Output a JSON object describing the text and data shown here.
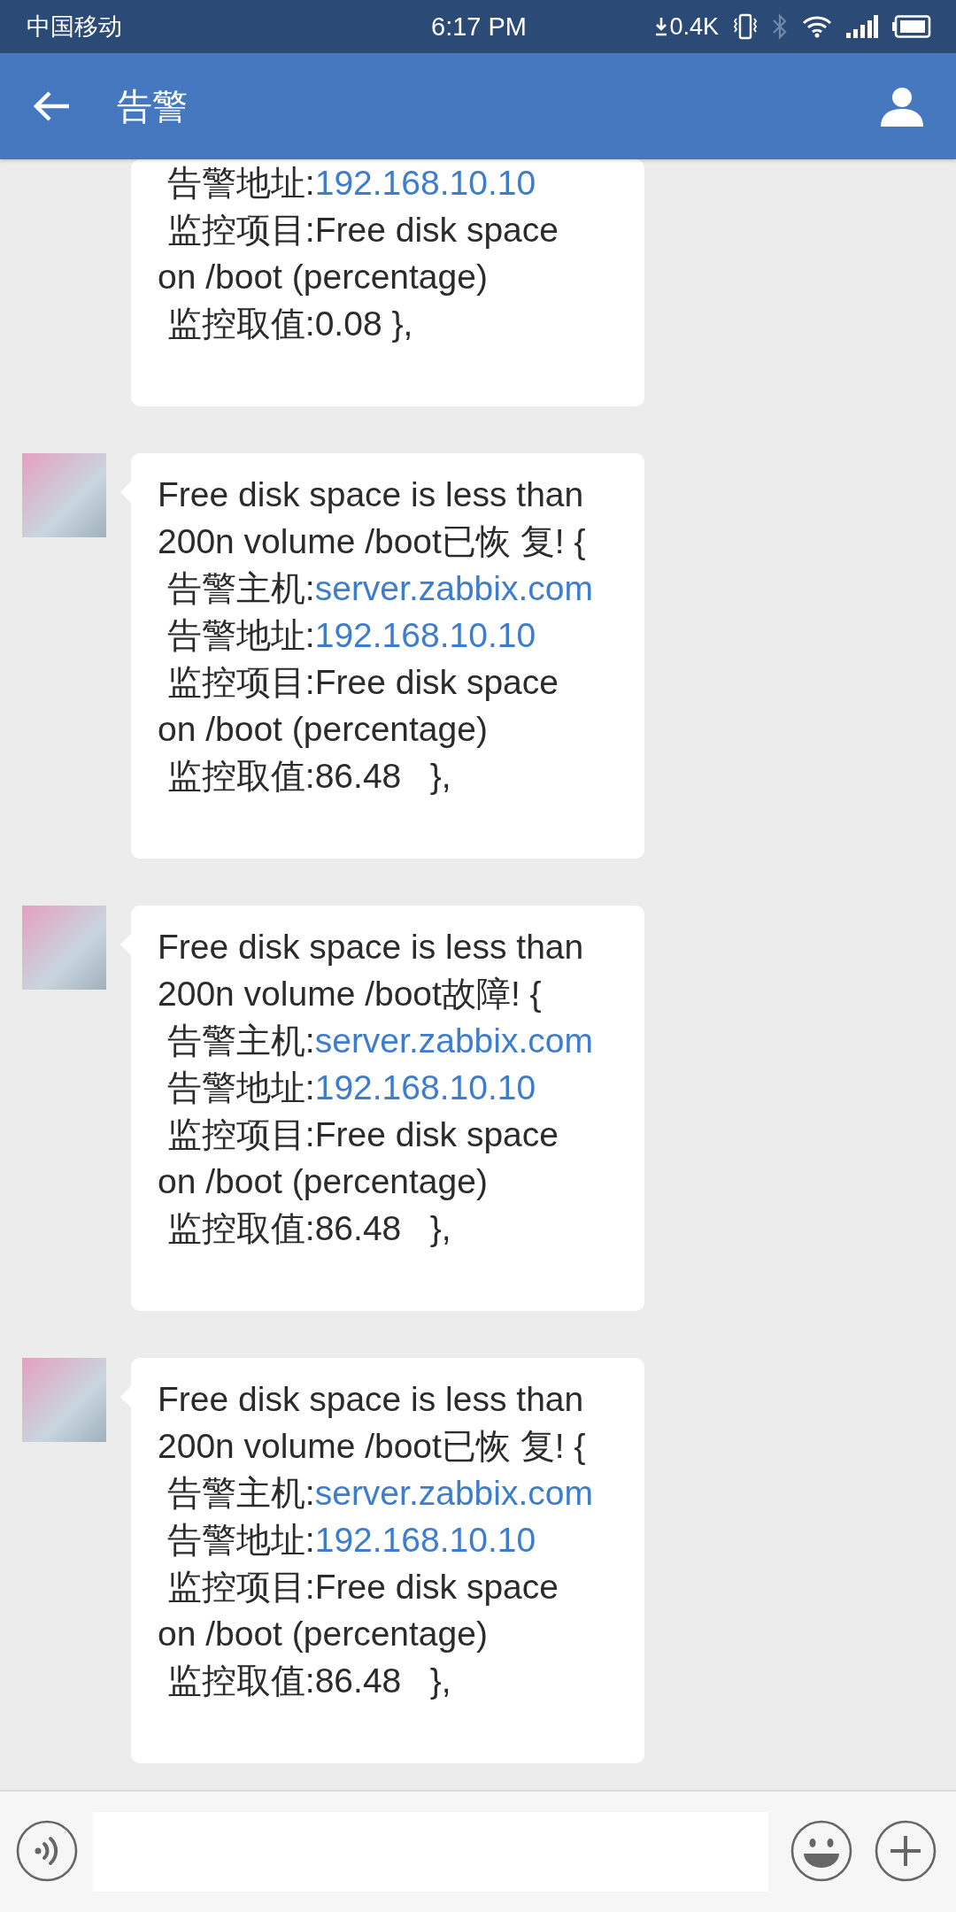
{
  "status_bar": {
    "carrier": "中国移动",
    "time": "6:17 PM",
    "net_speed": "0.4K"
  },
  "header": {
    "title": "告警"
  },
  "messages": [
    {
      "avatar": false,
      "lines": [
        {
          "label": " 告警地址:",
          "link": "192.168.10.10"
        },
        {
          "label": " 监控项目:Free disk space\non /boot (percentage)"
        },
        {
          "label": " 监控取值:0.08 },"
        }
      ]
    },
    {
      "avatar": true,
      "lines": [
        {
          "label": "Free disk space is less than\n200n volume /boot已恢 复! {"
        },
        {
          "label": " 告警主机:",
          "link": "server.zabbix.com"
        },
        {
          "label": " 告警地址:",
          "link": "192.168.10.10"
        },
        {
          "label": " 监控项目:Free disk space\non /boot (percentage)"
        },
        {
          "label": " 监控取值:86.48   },"
        }
      ]
    },
    {
      "avatar": true,
      "lines": [
        {
          "label": "Free disk space is less than\n200n volume /boot故障! {"
        },
        {
          "label": " 告警主机:",
          "link": "server.zabbix.com"
        },
        {
          "label": " 告警地址:",
          "link": "192.168.10.10"
        },
        {
          "label": " 监控项目:Free disk space\non /boot (percentage)"
        },
        {
          "label": " 监控取值:86.48   },"
        }
      ]
    },
    {
      "avatar": true,
      "lines": [
        {
          "label": "Free disk space is less than\n200n volume /boot已恢 复! {"
        },
        {
          "label": " 告警主机:",
          "link": "server.zabbix.com"
        },
        {
          "label": " 告警地址:",
          "link": "192.168.10.10"
        },
        {
          "label": " 监控项目:Free disk space\non /boot (percentage)"
        },
        {
          "label": " 监控取值:86.48   },"
        }
      ]
    }
  ]
}
